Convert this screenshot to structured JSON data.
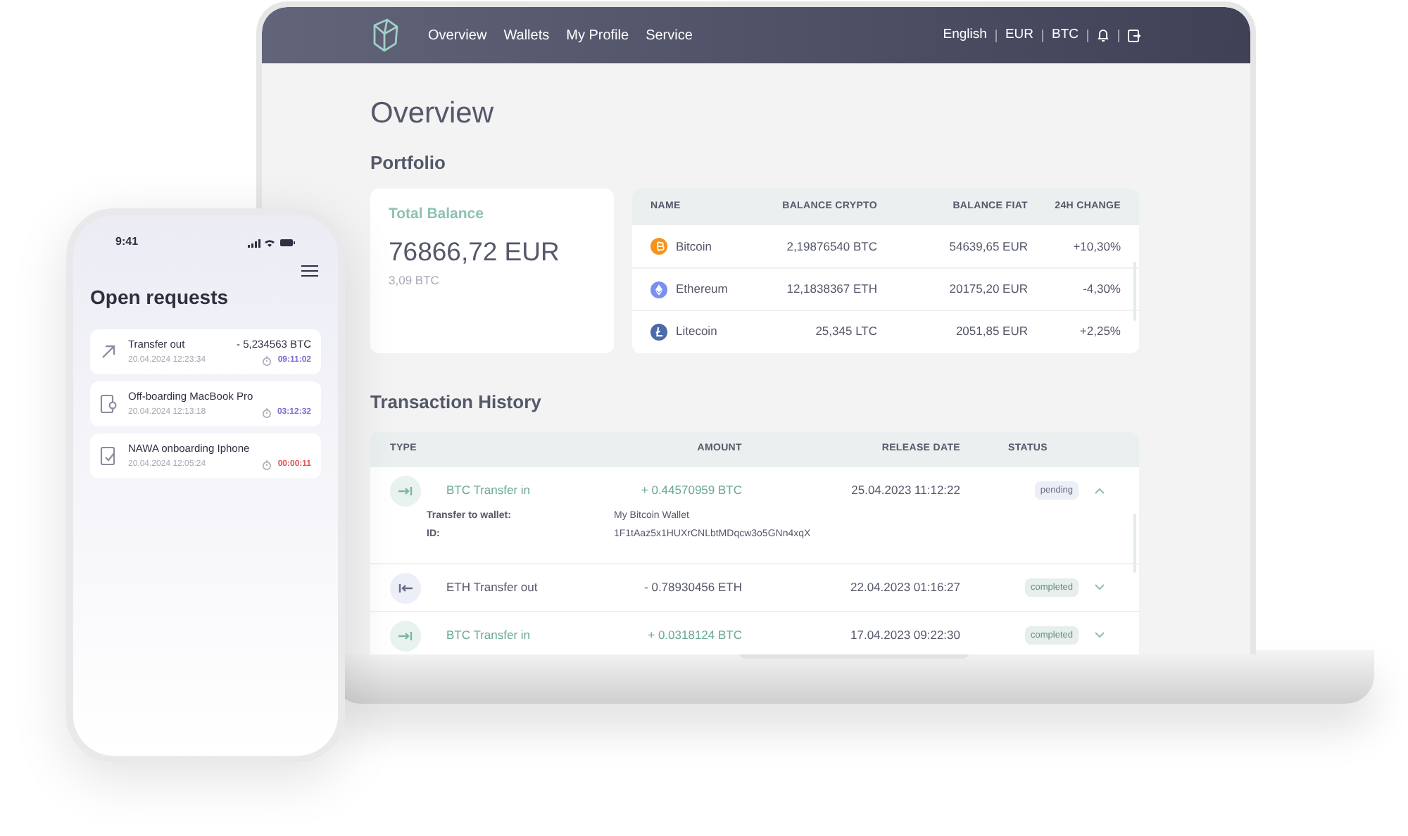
{
  "nav": {
    "links": [
      "Overview",
      "Wallets",
      "My Profile",
      "Service"
    ],
    "right": [
      "English",
      "EUR",
      "BTC"
    ]
  },
  "page": {
    "title": "Overview",
    "portfolio_heading": "Portfolio",
    "history_heading": "Transaction History"
  },
  "total_balance": {
    "label": "Total Balance",
    "amount": "76866,72 EUR",
    "crypto": "3,09 BTC"
  },
  "assets": {
    "columns": [
      "NAME",
      "BALANCE CRYPTO",
      "BALANCE FIAT",
      "24H CHANGE"
    ],
    "rows": [
      {
        "kind": "bitcoin",
        "color": "#f7931a",
        "name": "Bitcoin",
        "crypto": "2,19876540 BTC",
        "fiat": "54639,65 EUR",
        "change": "+10,30%"
      },
      {
        "kind": "ethereum",
        "color": "#7b8ff0",
        "name": "Ethereum",
        "crypto": "12,1838367 ETH",
        "fiat": "20175,20 EUR",
        "change": "-4,30%"
      },
      {
        "kind": "litecoin",
        "color": "#4b6aa8",
        "name": "Litecoin",
        "crypto": "25,345 LTC",
        "fiat": "2051,85 EUR",
        "change": "+2,25%"
      }
    ]
  },
  "transactions": {
    "columns": [
      "TYPE",
      "AMOUNT",
      "RELEASE DATE",
      "STATUS"
    ],
    "rows": [
      {
        "kind": "in",
        "type": "BTC Transfer in",
        "amount": "+ 0.44570959 BTC",
        "date": "25.04.2023 11:12:22",
        "status": {
          "kind": "pending",
          "label": "pending"
        },
        "expanded": true,
        "details": [
          {
            "label": "Transfer to wallet:",
            "value": "My Bitcoin Wallet"
          },
          {
            "label": "ID:",
            "value": "1F1tAaz5x1HUXrCNLbtMDqcw3o5GNn4xqX"
          }
        ]
      },
      {
        "kind": "out",
        "type": "ETH Transfer out",
        "amount": "- 0.78930456 ETH",
        "date": "22.04.2023 01:16:27",
        "status": {
          "kind": "completed",
          "label": "completed"
        },
        "expanded": false
      },
      {
        "kind": "in",
        "type": "BTC Transfer in",
        "amount": "+ 0.0318124 BTC",
        "date": "17.04.2023 09:22:30",
        "status": {
          "kind": "completed",
          "label": "completed"
        },
        "expanded": false
      }
    ]
  },
  "phone": {
    "time": "9:41",
    "title": "Open requests",
    "requests": [
      {
        "kind": "transfer",
        "title": "Transfer out",
        "amount": "- 5,234563 BTC",
        "date": "20.04.2024 12:23:34",
        "timer": "09:11:02",
        "color": "#7c6fd6"
      },
      {
        "kind": "device",
        "title": "Off-boarding MacBook Pro",
        "date": "20.04.2024 12:13:18",
        "timer": "03:12:32",
        "color": "#7c6fd6"
      },
      {
        "kind": "onboarding",
        "title": "NAWA onboarding Iphone",
        "date": "20.04.2024 12:05:24",
        "timer": "00:00:11",
        "color": "#e25656"
      }
    ]
  }
}
